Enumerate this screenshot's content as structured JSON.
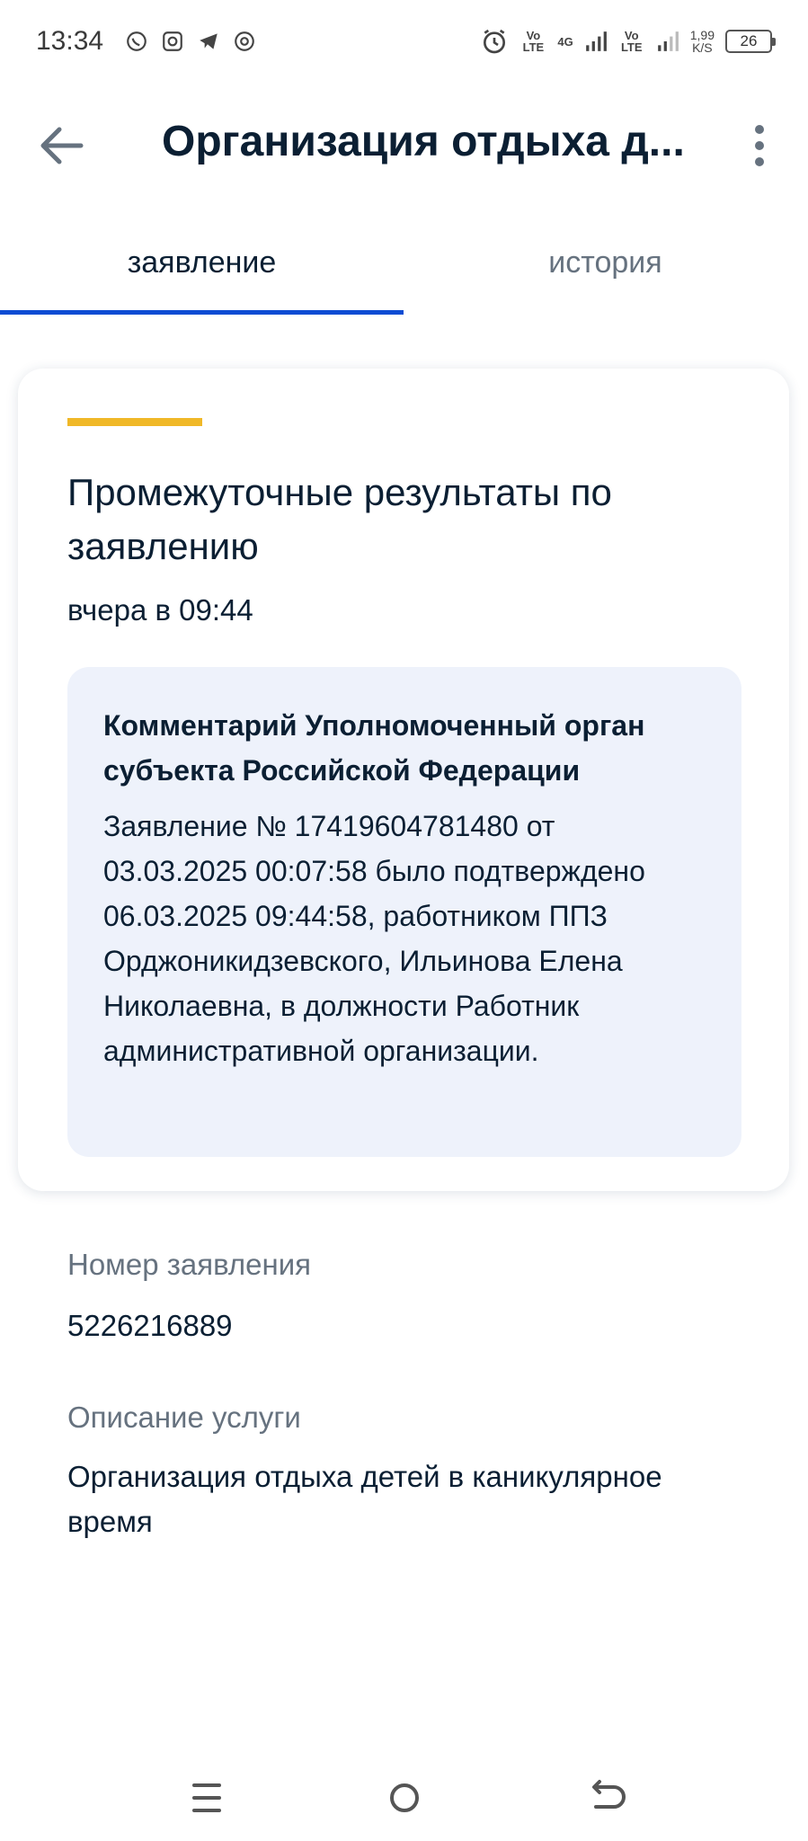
{
  "status_bar": {
    "time": "13:34",
    "net1": "Vo LTE",
    "net2": "4G",
    "net3": "Vo LTE",
    "speed_value": "1,99",
    "speed_unit": "K/S",
    "battery": "26"
  },
  "app_bar": {
    "title": "Организация отдыха д..."
  },
  "tabs": [
    {
      "label": "заявление",
      "active": true
    },
    {
      "label": "история",
      "active": false
    }
  ],
  "card": {
    "accent_color": "#f0b828",
    "title": "Промежуточные результаты по заявлению",
    "date": "вчера в 09:44",
    "comment": {
      "title": "Комментарий Уполномоченный орган субъекта Российской Федерации",
      "text": "Заявление № 17419604781480 от 03.03.2025 00:07:58 было подтверждено 06.03.2025 09:44:58, работником ППЗ Орджоникидзевского, Ильинова Елена Николаевна, в должности Работник административной организации."
    }
  },
  "details": {
    "application_number_label": "Номер заявления",
    "application_number_value": "5226216889",
    "service_description_label": "Описание услуги",
    "service_description_value": "Организация отдыха детей в каникулярное время"
  },
  "colors": {
    "tab_indicator": "#0d4cd3",
    "comment_bg": "#eef2fb",
    "secondary_text": "#66727f"
  }
}
